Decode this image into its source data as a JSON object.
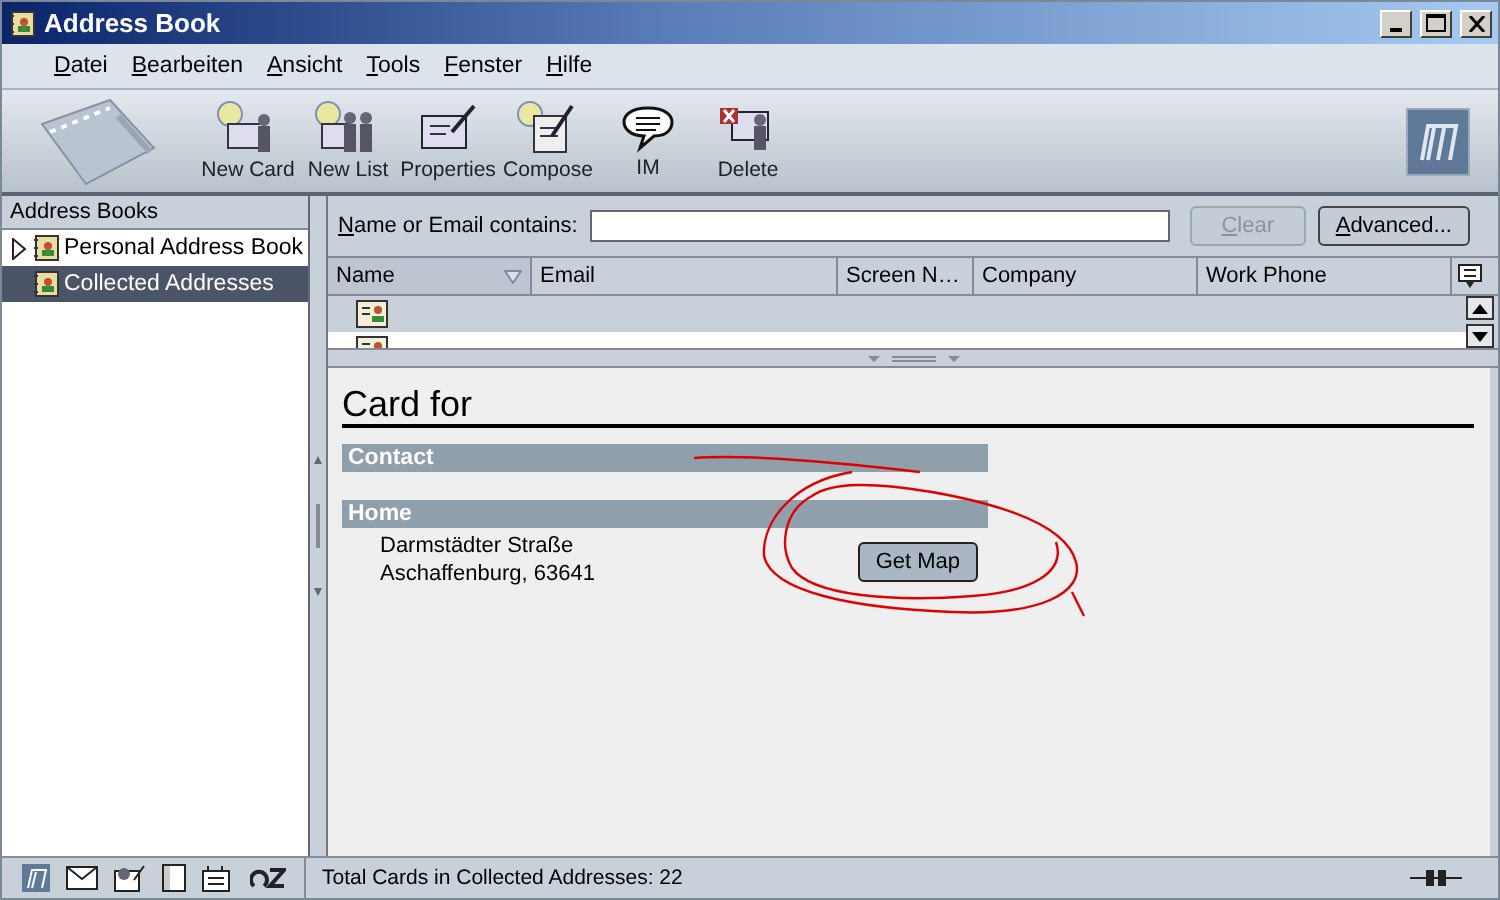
{
  "window": {
    "title": "Address Book"
  },
  "menu": [
    "Datei",
    "Bearbeiten",
    "Ansicht",
    "Tools",
    "Fenster",
    "Hilfe"
  ],
  "toolbar": [
    {
      "label": "New Card",
      "kind": "new-card"
    },
    {
      "label": "New List",
      "kind": "new-list"
    },
    {
      "label": "Properties",
      "kind": "properties"
    },
    {
      "label": "Compose",
      "kind": "compose"
    },
    {
      "label": "IM",
      "kind": "im"
    },
    {
      "label": "Delete",
      "kind": "delete"
    }
  ],
  "sidebar": {
    "header": "Address Books",
    "items": [
      {
        "label": "Personal Address Book",
        "selected": false,
        "expanded": false
      },
      {
        "label": "Collected Addresses",
        "selected": true
      }
    ]
  },
  "search": {
    "label": "Name or Email contains:",
    "clear": {
      "label": "Clear",
      "disabled": true
    },
    "advanced": "Advanced..."
  },
  "table": {
    "columns": [
      {
        "label": "Name",
        "sorted": true
      },
      {
        "label": "Email",
        "sorted": false
      },
      {
        "label": "Screen N…",
        "sorted": false
      },
      {
        "label": "Company",
        "sorted": false
      },
      {
        "label": "Work Phone",
        "sorted": false
      }
    ],
    "rows": [
      {
        "kind": "card"
      },
      {
        "kind": "card"
      }
    ]
  },
  "card": {
    "title": "Card for",
    "sections": [
      {
        "heading": "Contact"
      },
      {
        "heading": "Home",
        "lines": [
          "Darmstädter Straße",
          "Aschaffenburg, 63641"
        ],
        "button": "Get Map"
      }
    ]
  },
  "status_bar": {
    "text": "Total Cards in Collected Addresses: 22"
  }
}
